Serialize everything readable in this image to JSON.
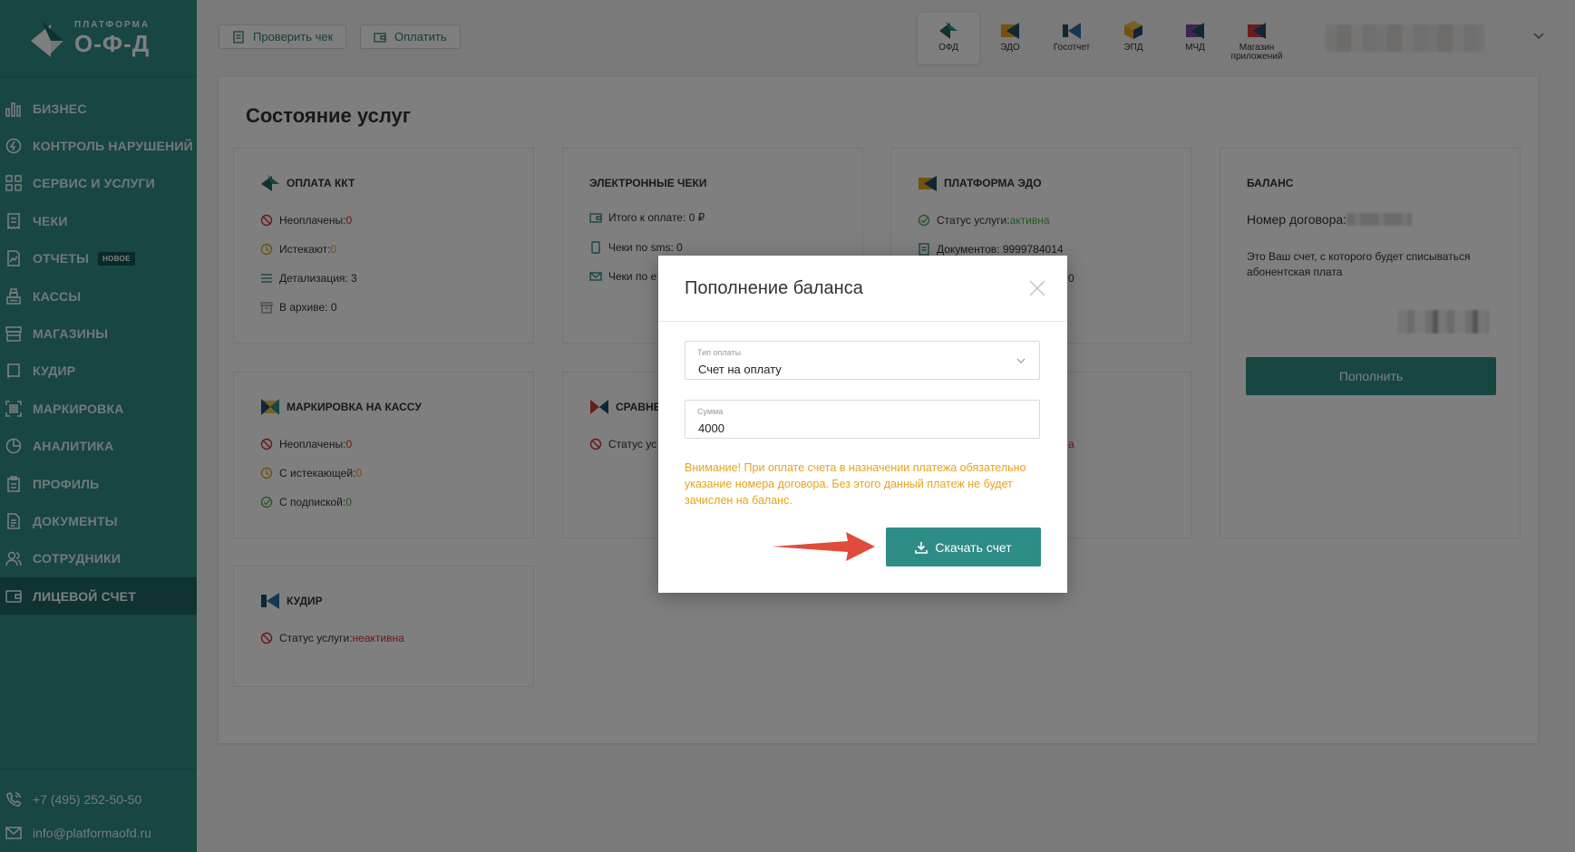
{
  "brand": {
    "small": "ПЛАТФОРМА",
    "big": "О-Ф-Д"
  },
  "sidebar": {
    "items": [
      {
        "label": "БИЗНЕС",
        "icon": "bar-chart-icon"
      },
      {
        "label": "КОНТРОЛЬ НАРУШЕНИЙ",
        "icon": "lightning-circle-icon"
      },
      {
        "label": "СЕРВИС И УСЛУГИ",
        "icon": "grid-icon"
      },
      {
        "label": "ЧЕКИ",
        "icon": "receipt-icon"
      },
      {
        "label": "ОТЧЕТЫ",
        "icon": "report-chart-icon",
        "badge": "НОВОЕ"
      },
      {
        "label": "КАССЫ",
        "icon": "cash-register-icon"
      },
      {
        "label": "МАГАЗИНЫ",
        "icon": "store-icon"
      },
      {
        "label": "КУДиР",
        "icon": "book-icon"
      },
      {
        "label": "МАРКИРОВКА",
        "icon": "qr-scan-icon"
      },
      {
        "label": "АНАЛИТИКА",
        "icon": "pie-chart-icon"
      },
      {
        "label": "ПРОФИЛЬ",
        "icon": "clipboard-icon"
      },
      {
        "label": "ДОКУМЕНТЫ",
        "icon": "document-icon"
      },
      {
        "label": "СОТРУДНИКИ",
        "icon": "users-icon"
      },
      {
        "label": "ЛИЦЕВОЙ СЧЕТ",
        "icon": "wallet-icon",
        "active": true
      }
    ],
    "phone": "+7 (495) 252-50-50",
    "email": "info@platformaofd.ru"
  },
  "topbar": {
    "check_label": "Проверить чек",
    "pay_label": "Оплатить",
    "products": [
      {
        "label": "ОФД"
      },
      {
        "label": "ЭДО"
      },
      {
        "label": "Госотчет"
      },
      {
        "label": "ЭПД"
      },
      {
        "label": "МЧД"
      },
      {
        "label": "Магазин приложений"
      }
    ]
  },
  "main": {
    "title": "Состояние услуг",
    "kkt": {
      "title": "ОПЛАТА ККТ",
      "unpaid_label": "Неоплачены: ",
      "unpaid": "0",
      "expiring_label": "Истекают: ",
      "expiring": "0",
      "details": "Детализация: 3",
      "archive": "В архиве: 0"
    },
    "echecks": {
      "title": "ЭЛЕКТРОННЫЕ ЧЕКИ",
      "total": "Итого к оплате: 0 ₽",
      "sms": "Чеки по sms: 0",
      "email": "Чеки по e"
    },
    "edo": {
      "title": "ПЛАТФОРМА ЭДО",
      "status_label": "Статус услуги: ",
      "status": "активна",
      "docs": "Документов: 9999784014",
      "partial": "0"
    },
    "balance": {
      "title": "БАЛАНС",
      "contract_label": "Номер договора:",
      "note": "Это Ваш счет, с которого будет списываться абонентская плата",
      "topup": "Пополнить"
    },
    "marking": {
      "title": "МАРКИРОВКА НА КАССУ",
      "unpaid_label": "Неоплачены: ",
      "unpaid": "0",
      "expiring_label": "С истекающей: ",
      "expiring": "0",
      "sub_label": "С подпиской: ",
      "sub": "0"
    },
    "compare": {
      "title": "СРАВНЕ",
      "status": "Статус ус",
      "partial_right": "а"
    },
    "kudir": {
      "title": "КУДИР",
      "status_label": "Статус услуги: ",
      "status": "неактивна"
    }
  },
  "modal": {
    "title": "Пополнение баланса",
    "type_label": "Тип оплаты",
    "type_value": "Счет на оплату",
    "sum_label": "Сумма",
    "sum_value": "4000",
    "warning": "Внимание! При оплате счета в назначении платежа обязательно указание номера договора. Без этого данный платеж не будет зачислен на баланс.",
    "download": "Скачать счет"
  },
  "colors": {
    "brand": "#2e8c87",
    "sidebar_active": "#1d6662",
    "warning": "#e8a21b",
    "danger": "#d32f2f",
    "success": "#4caf50",
    "arrow": "#e04b3c"
  }
}
